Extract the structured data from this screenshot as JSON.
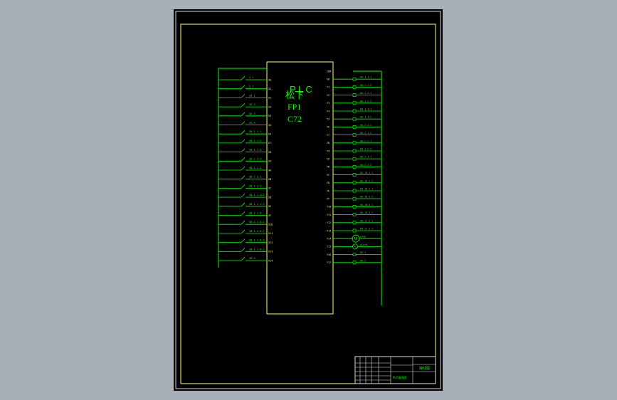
{
  "colors": {
    "background": "#a7b0b9",
    "sheet": "#000000",
    "frame": "#ffff66",
    "wire": "#00ff00",
    "title_block": "#e0e0e0",
    "title_text": "#00ff00"
  },
  "plc": {
    "title": "P L C",
    "maker": "松下",
    "model_line1": "FP1",
    "model_line2": "C72"
  },
  "inputs": [
    {
      "label": "S 1",
      "terminal": "X0"
    },
    {
      "label": "S 2",
      "terminal": "X1"
    },
    {
      "label": "SQ 1",
      "terminal": "X2"
    },
    {
      "label": "SQ 2",
      "terminal": "X3"
    },
    {
      "label": "SQ 3",
      "terminal": "X4"
    },
    {
      "label": "SQ 4",
      "terminal": "X5"
    },
    {
      "label": "SB-1-1-1",
      "terminal": "X6"
    },
    {
      "label": "SB-1-1-2",
      "terminal": "X7"
    },
    {
      "label": "SB-1-1-3",
      "terminal": "X8"
    },
    {
      "label": "SB-1-2-1",
      "terminal": "X9"
    },
    {
      "label": "SB-1-2-2",
      "terminal": "XA"
    },
    {
      "label": "SB-1-3-1",
      "terminal": "XB"
    },
    {
      "label": "SB-1-3-2",
      "terminal": "XC"
    },
    {
      "label": "SB-1-1-4-1",
      "terminal": "XD"
    },
    {
      "label": "SB-1-1-1-3",
      "terminal": "XE"
    },
    {
      "label": "SB-1-1-4",
      "terminal": "XF"
    },
    {
      "label": "SB-1-1-5-1",
      "terminal": "X10"
    },
    {
      "label": "SB-1-1-5-2",
      "terminal": "X11"
    },
    {
      "label": "SB-1-1-6-1",
      "terminal": "X12"
    },
    {
      "label": "SB-1-1-6-2",
      "terminal": "X13"
    },
    {
      "label": "SB-5",
      "terminal": "X14"
    }
  ],
  "outputs": [
    {
      "label": "",
      "terminal": "Y0",
      "kind": "com"
    },
    {
      "label": "KA-1-1-1",
      "terminal": "Y0",
      "kind": "coil"
    },
    {
      "label": "KA-1-1-2",
      "terminal": "Y1",
      "kind": "coil"
    },
    {
      "label": "KA-1-2-1",
      "terminal": "Y2",
      "kind": "coil"
    },
    {
      "label": "KA-1-2-2",
      "terminal": "Y3",
      "kind": "coil"
    },
    {
      "label": "KA-1-3-1",
      "terminal": "Y4",
      "kind": "coil"
    },
    {
      "label": "KA-1-3-2",
      "terminal": "Y5",
      "kind": "coil"
    },
    {
      "label": "KA-2-1-1",
      "terminal": "Y6",
      "kind": "coil"
    },
    {
      "label": "KA-2-1-2",
      "terminal": "Y7",
      "kind": "coil"
    },
    {
      "label": "KA-2-2-1",
      "terminal": "Y8",
      "kind": "coil"
    },
    {
      "label": "KA-2-2-2",
      "terminal": "Y9",
      "kind": "coil"
    },
    {
      "label": "KA-2-3-1",
      "terminal": "YA",
      "kind": "coil"
    },
    {
      "label": "KA-2-3-2",
      "terminal": "YB",
      "kind": "coil"
    },
    {
      "label": "KA-10-1-1",
      "terminal": "YC",
      "kind": "coil"
    },
    {
      "label": "KA-10-1-2",
      "terminal": "YD",
      "kind": "coil"
    },
    {
      "label": "KA-10-2-1",
      "terminal": "YE",
      "kind": "coil"
    },
    {
      "label": "KA-10-2-2",
      "terminal": "YF",
      "kind": "coil"
    },
    {
      "label": "KA-10-3-1",
      "terminal": "Y10",
      "kind": "coil"
    },
    {
      "label": "KA-10-3-2",
      "terminal": "Y11",
      "kind": "coil"
    },
    {
      "label": "KA-11-1-1",
      "terminal": "Y12",
      "kind": "coil"
    },
    {
      "label": "KA-11-1-2",
      "terminal": "Y13",
      "kind": "coil"
    },
    {
      "label": "pump",
      "terminal": "Y14",
      "kind": "motor"
    },
    {
      "label": "alarm",
      "terminal": "Y15",
      "kind": "lamp"
    },
    {
      "label": "KA-1",
      "terminal": "Y16",
      "kind": "coil"
    },
    {
      "label": "KA-2",
      "terminal": "Y17",
      "kind": "coil"
    }
  ],
  "title_block": {
    "drawing_name": "接线图",
    "sub": "PLC接线图"
  }
}
